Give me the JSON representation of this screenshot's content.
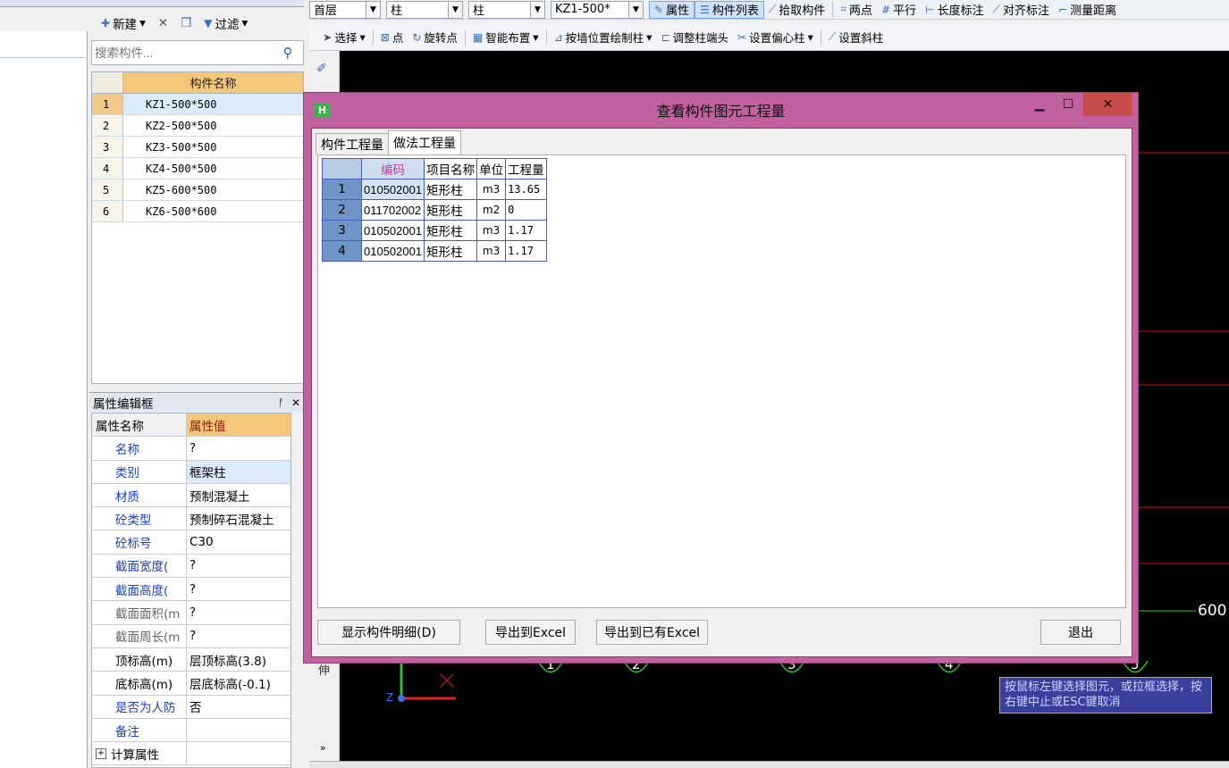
{
  "toolbar1": {
    "floor": "首层",
    "cat1": "柱",
    "cat2": "柱",
    "component": "KZ1-500*",
    "btn_property": "属性",
    "btn_list": "构件列表",
    "btn_pick": "拾取构件",
    "btn_twopoint": "两点",
    "btn_parallel": "平行",
    "btn_length": "长度标注",
    "btn_align": "对齐标注",
    "btn_measure": "测量距离"
  },
  "toolbar2": {
    "select": "选择",
    "point": "点",
    "rotate_point": "旋转点",
    "smart_layout": "智能布置",
    "draw_by_wall": "按墙位置绘制柱",
    "adjust_end": "调整柱端头",
    "set_offset": "设置偏心柱",
    "set_slant": "设置斜柱"
  },
  "component_panel": {
    "new": "新建",
    "filter": "过滤",
    "search_placeholder": "搜索构件...",
    "header": "构件名称",
    "rows": [
      {
        "n": "1",
        "name": "KZ1-500*500"
      },
      {
        "n": "2",
        "name": "KZ2-500*500"
      },
      {
        "n": "3",
        "name": "KZ3-500*500"
      },
      {
        "n": "4",
        "name": "KZ4-500*500"
      },
      {
        "n": "5",
        "name": "KZ5-600*500"
      },
      {
        "n": "6",
        "name": "KZ6-500*600"
      }
    ]
  },
  "property_panel": {
    "title": "属性编辑框",
    "col_name": "属性名称",
    "col_value": "属性值",
    "rows": [
      {
        "name": "名称",
        "value": "?"
      },
      {
        "name": "类别",
        "value": "框架柱"
      },
      {
        "name": "材质",
        "value": "预制混凝土"
      },
      {
        "name": "砼类型",
        "value": "预制碎石混凝土"
      },
      {
        "name": "砼标号",
        "value": "C30"
      },
      {
        "name": "截面宽度(",
        "value": "?"
      },
      {
        "name": "截面高度(",
        "value": "?"
      },
      {
        "name": "截面面积(m",
        "value": "?"
      },
      {
        "name": "截面周长(m",
        "value": "?"
      },
      {
        "name": "顶标高(m)",
        "value": "层顶标高(3.8)"
      },
      {
        "name": "底标高(m)",
        "value": "层底标高(-0.1)"
      },
      {
        "name": "是否为人防",
        "value": "否"
      },
      {
        "name": "备注",
        "value": ""
      },
      {
        "name": "计算属性",
        "value": ""
      }
    ]
  },
  "dialog": {
    "title": "查看构件图元工程量",
    "tabs": [
      "构件工程量",
      "做法工程量"
    ],
    "columns": [
      "编码",
      "项目名称",
      "单位",
      "工程量"
    ],
    "rows": [
      {
        "n": "1",
        "code": "010502001",
        "name": "矩形柱",
        "unit": "m3",
        "qty": "13.65"
      },
      {
        "n": "2",
        "code": "011702002",
        "name": "矩形柱",
        "unit": "m2",
        "qty": "0"
      },
      {
        "n": "3",
        "code": "010502001",
        "name": "矩形柱",
        "unit": "m3",
        "qty": "1.17"
      },
      {
        "n": "4",
        "code": "010502001",
        "name": "矩形柱",
        "unit": "m3",
        "qty": "1.17"
      }
    ],
    "btn_detail": "显示构件明细(D)",
    "btn_export": "导出到Excel",
    "btn_export_existing": "导出到已有Excel",
    "btn_exit": "退出"
  },
  "canvas": {
    "axis_labels": [
      "1",
      "2",
      "3",
      "4",
      "5"
    ],
    "dim_label": "600",
    "side_label": "伸",
    "hint": "按鼠标左键选择图元，或拉框选择，按右键中止或ESC键取消"
  }
}
